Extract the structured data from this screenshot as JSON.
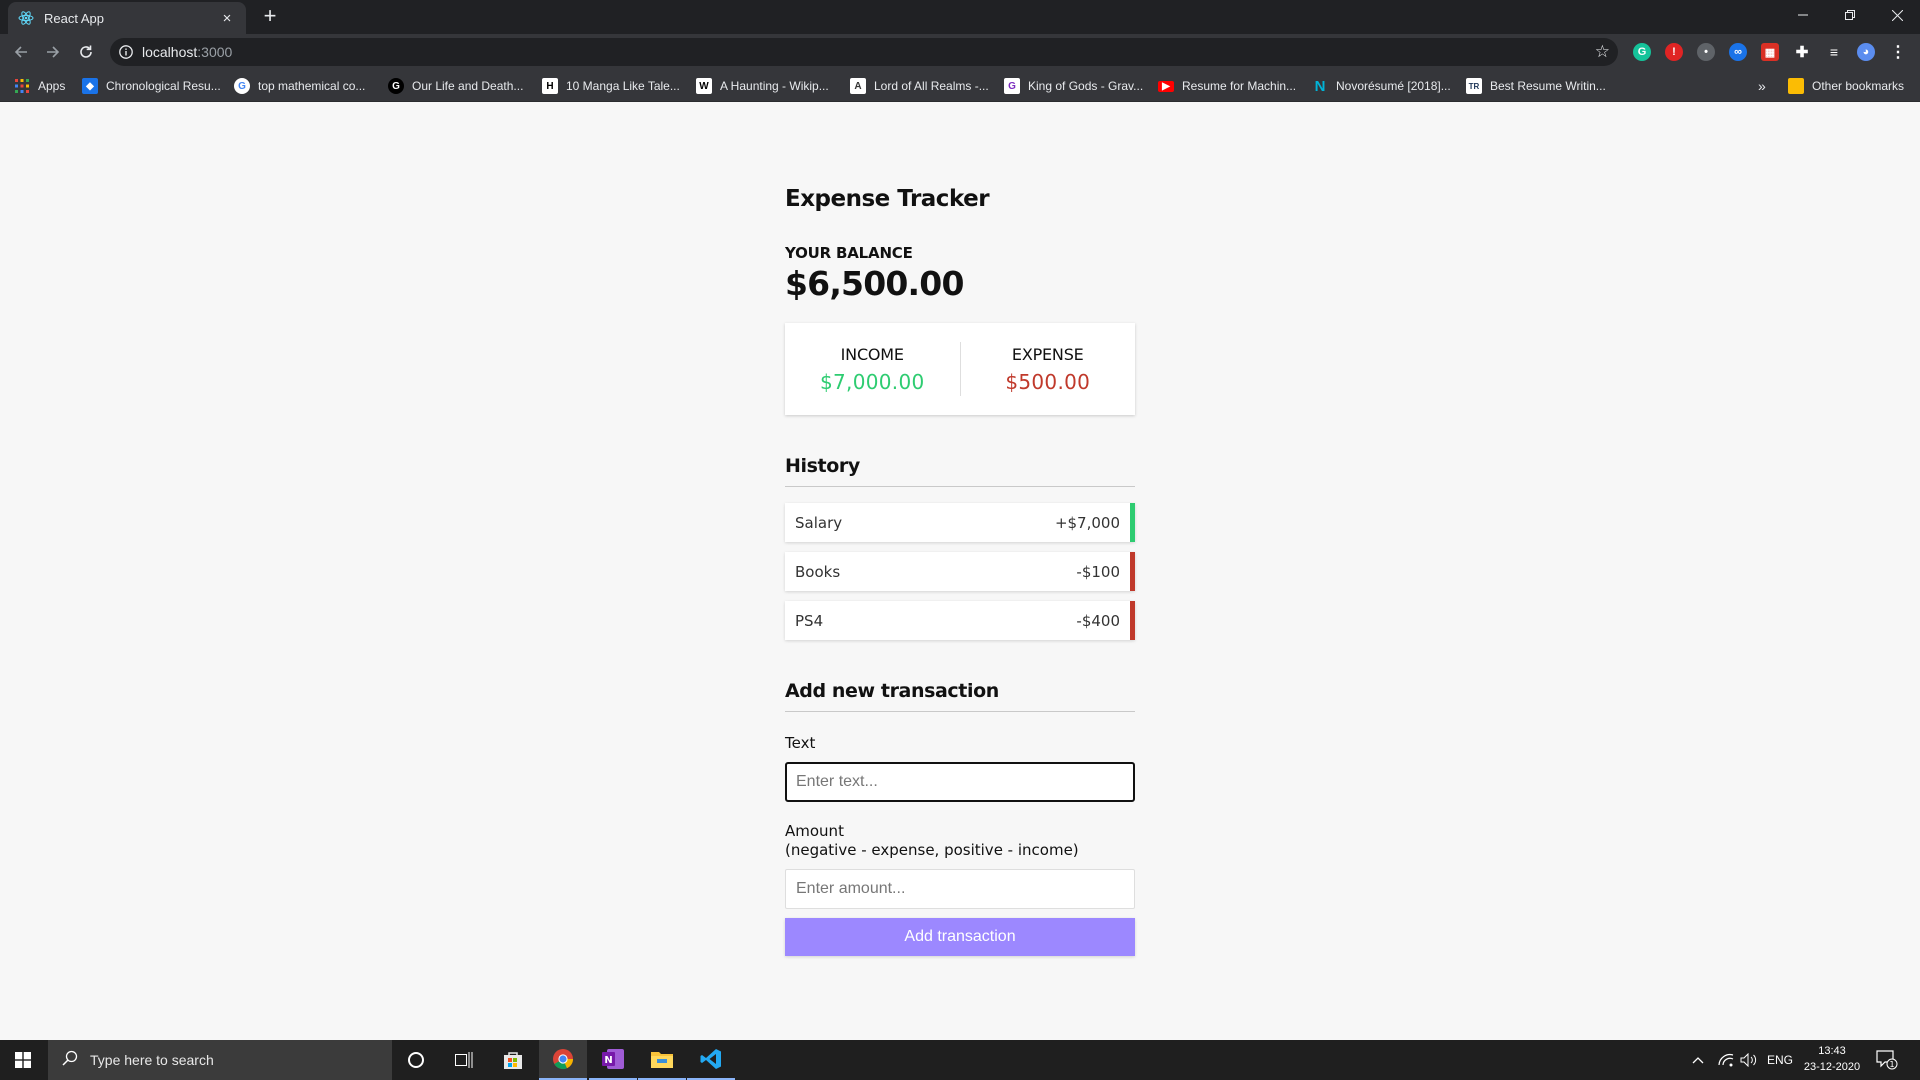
{
  "browser": {
    "tab_title": "React App",
    "tab_close": "×",
    "new_tab": "+",
    "url_host": "localhost",
    "url_port": ":3000",
    "bookmarks": [
      {
        "label": "Apps",
        "icon": "apps-grid-icon"
      },
      {
        "label": "Chronological Resu...",
        "icon": "bookmark-favicon"
      },
      {
        "label": "top mathemical co...",
        "icon": "google-icon"
      },
      {
        "label": "Our Life and Death...",
        "icon": "g-favicon"
      },
      {
        "label": "10 Manga Like Tale...",
        "icon": "h-favicon"
      },
      {
        "label": "A Haunting - Wikip...",
        "icon": "wikipedia-icon"
      },
      {
        "label": "Lord of All Realms -...",
        "icon": "a-favicon"
      },
      {
        "label": "King of Gods - Grav...",
        "icon": "gravity-favicon"
      },
      {
        "label": "Resume for Machin...",
        "icon": "youtube-icon"
      },
      {
        "label": "Novorésumé [2018]...",
        "icon": "novoresume-icon"
      },
      {
        "label": "Best Resume Writin...",
        "icon": "tr-favicon"
      }
    ],
    "more_bookmarks": "»",
    "other_bookmarks": "Other bookmarks"
  },
  "app": {
    "title": "Expense Tracker",
    "balance_label": "YOUR BALANCE",
    "balance_value": "$6,500.00",
    "income_label": "INCOME",
    "income_value": "$7,000.00",
    "expense_label": "EXPENSE",
    "expense_value": "$500.00",
    "history_title": "History",
    "transactions": [
      {
        "text": "Salary",
        "amount": "+$7,000",
        "type": "plus"
      },
      {
        "text": "Books",
        "amount": "-$100",
        "type": "minus"
      },
      {
        "text": "PS4",
        "amount": "-$400",
        "type": "minus"
      }
    ],
    "add_title": "Add new transaction",
    "text_label": "Text",
    "text_placeholder": "Enter text...",
    "amount_label": "Amount",
    "amount_hint": "(negative - expense, positive - income)",
    "amount_placeholder": "Enter amount...",
    "add_button": "Add transaction"
  },
  "colors": {
    "income": "#2ecc71",
    "expense": "#c0392b",
    "button": "#9c88ff"
  },
  "taskbar": {
    "search_placeholder": "Type here to search",
    "language": "ENG",
    "time": "13:43",
    "date": "23-12-2020",
    "notification_count": "1"
  }
}
